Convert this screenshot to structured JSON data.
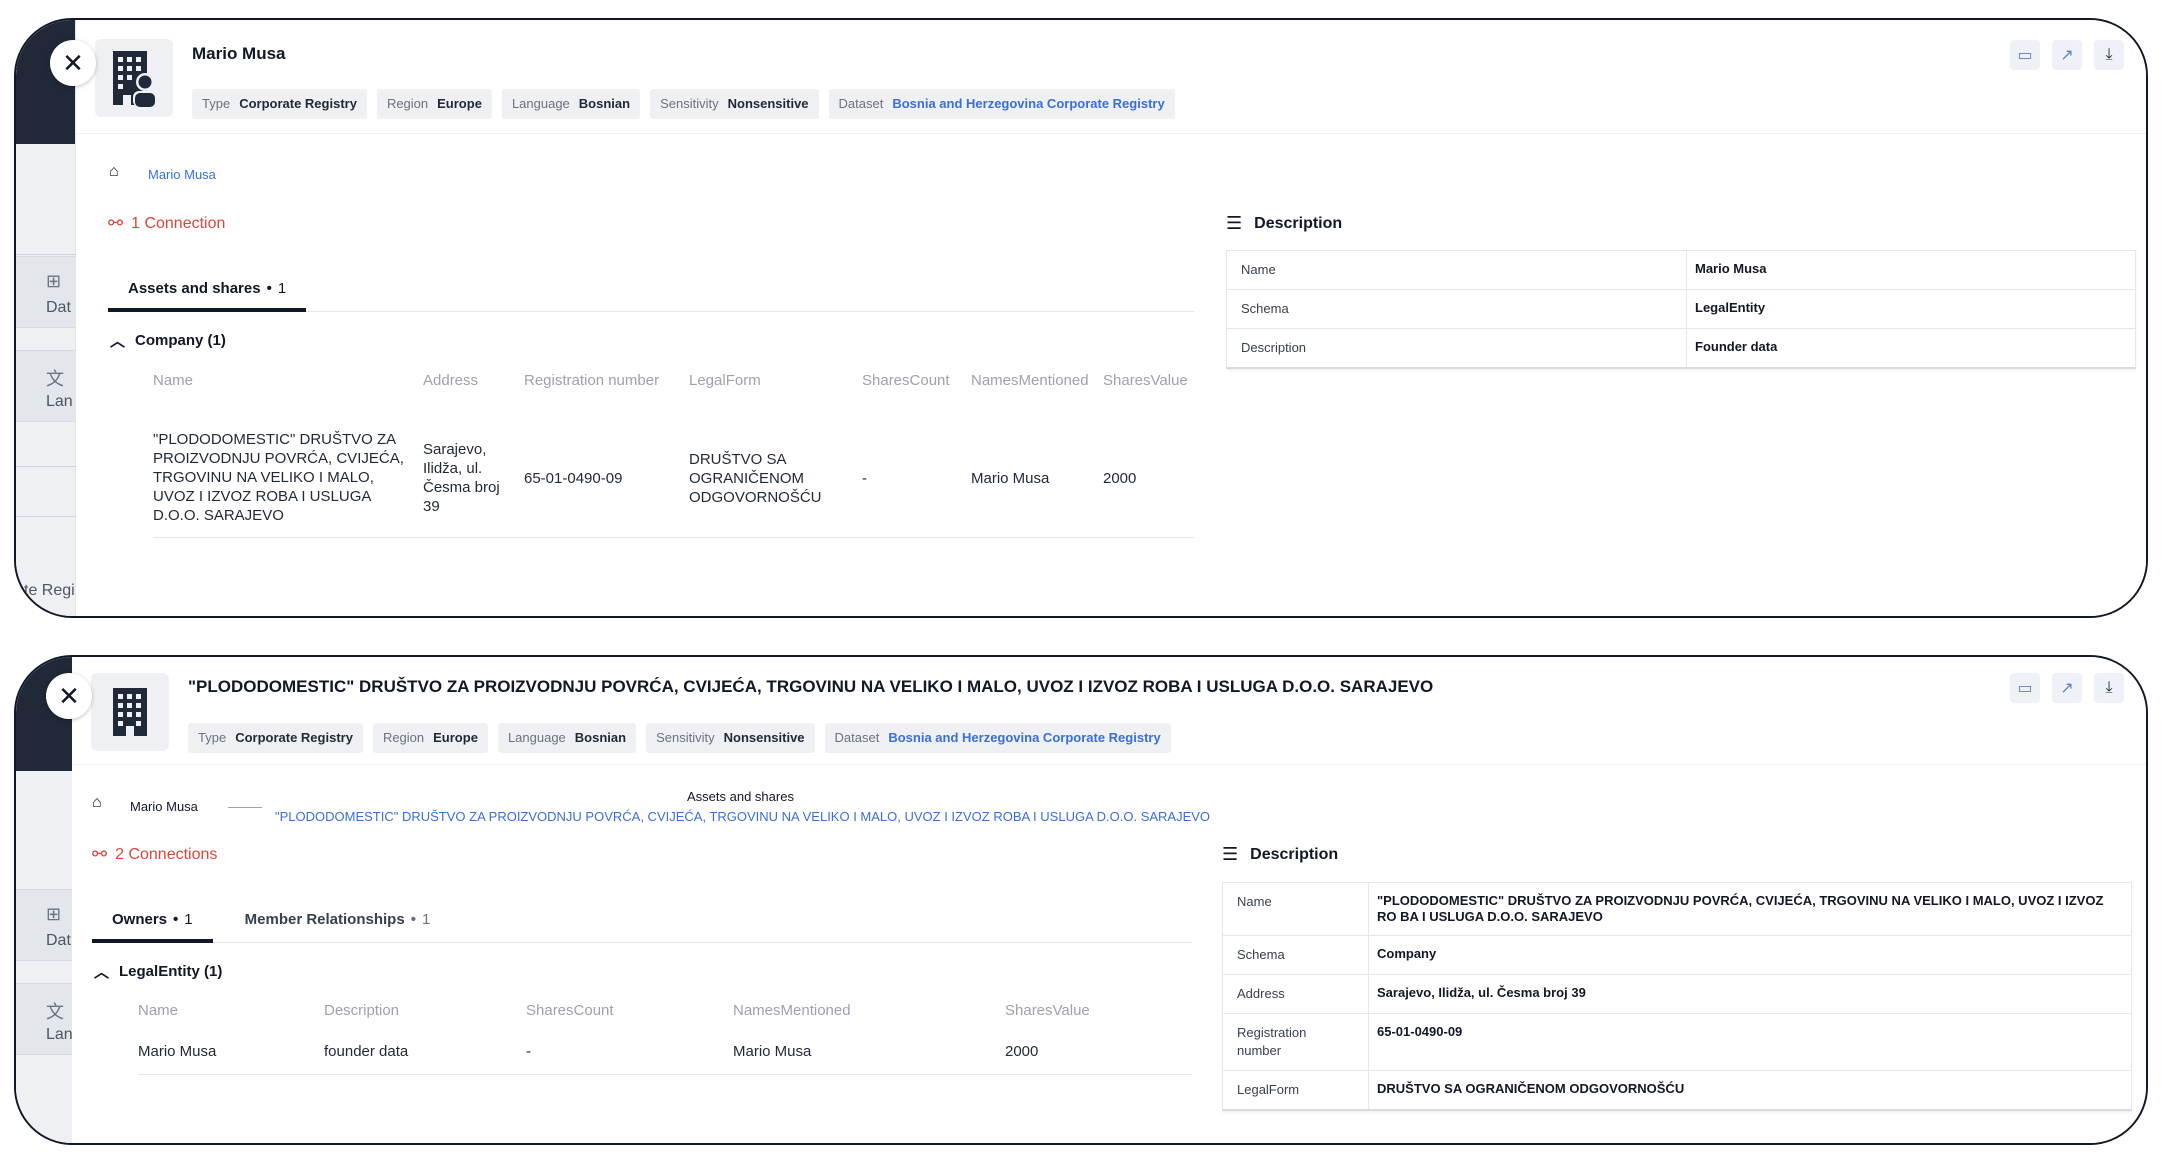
{
  "panel1": {
    "title": "Mario Musa",
    "bg": {
      "label_a": "Dat",
      "label_b": "Lan",
      "label_c": "te Regi"
    },
    "tags": [
      {
        "key": "Type",
        "value": "Corporate Registry"
      },
      {
        "key": "Region",
        "value": "Europe"
      },
      {
        "key": "Language",
        "value": "Bosnian"
      },
      {
        "key": "Sensitivity",
        "value": "Nonsensitive"
      },
      {
        "key": "Dataset",
        "value": "Bosnia and Herzegovina Corporate Registry"
      }
    ],
    "breadcrumb": {
      "current": "Mario Musa"
    },
    "connections": "1 Connection",
    "tab": {
      "label": "Assets and shares",
      "count": "1"
    },
    "group": "Company (1)",
    "table": {
      "headers": [
        "Name",
        "Address",
        "Registration number",
        "LegalForm",
        "SharesCount",
        "NamesMentioned",
        "SharesValue"
      ],
      "row": {
        "name": "\"PLODODOMESTIC\" DRUŠTVO ZA PROIZVODNJU POVRĆA, CVIJEĆA, TRGOVINU NA VELIKO I MALO, UVOZ I IZVOZ ROBA I USLUGA D.O.O. SARAJEVO",
        "address": "Sarajevo, Ilidža, ul. Česma broj 39",
        "registration": "65-01-0490-09",
        "legalform": "DRUŠTVO SA OGRANIČENOM ODGOVORNOŠĆU",
        "sharescount": "-",
        "names": "Mario Musa",
        "value": "2000"
      }
    },
    "description": {
      "title": "Description",
      "rows": [
        {
          "key": "Name",
          "value": "Mario Musa"
        },
        {
          "key": "Schema",
          "value": "LegalEntity"
        },
        {
          "key": "Description",
          "value": "Founder data"
        }
      ]
    }
  },
  "panel2": {
    "title": "\"PLODODOMESTIC\" DRUŠTVO ZA PROIZVODNJU POVRĆA, CVIJEĆA, TRGOVINU NA VELIKO I MALO, UVOZ I IZVOZ ROBA I USLUGA D.O.O. SARAJEVO",
    "bg": {
      "label_a": "Dat",
      "label_b": "Lan"
    },
    "tags": [
      {
        "key": "Type",
        "value": "Corporate Registry"
      },
      {
        "key": "Region",
        "value": "Europe"
      },
      {
        "key": "Language",
        "value": "Bosnian"
      },
      {
        "key": "Sensitivity",
        "value": "Nonsensitive"
      },
      {
        "key": "Dataset",
        "value": "Bosnia and Herzegovina Corporate Registry"
      }
    ],
    "breadcrumb": {
      "parent": "Mario Musa",
      "relation": "Assets and shares",
      "current": "\"PLODODOMESTIC\" DRUŠTVO ZA PROIZVODNJU POVRĆA, CVIJEĆA, TRGOVINU NA VELIKO I MALO, UVOZ I IZVOZ ROBA I USLUGA D.O.O. SARAJEVO"
    },
    "connections": "2 Connections",
    "tabs": [
      {
        "label": "Owners",
        "count": "1"
      },
      {
        "label": "Member Relationships",
        "count": "1"
      }
    ],
    "group": "LegalEntity (1)",
    "table": {
      "headers": [
        "Name",
        "Description",
        "SharesCount",
        "NamesMentioned",
        "SharesValue"
      ],
      "row": {
        "name": "Mario Musa",
        "description": "founder data",
        "sharescount": "-",
        "names": "Mario Musa",
        "value": "2000"
      }
    },
    "description": {
      "title": "Description",
      "rows": [
        {
          "key": "Name",
          "value": "\"PLODODOMESTIC\" DRUŠTVO ZA PROIZVODNJU POVRĆA, CVIJEĆA, TRGOVINU NA VELIKO I MALO, UVOZ I IZVOZ RO BA I USLUGA D.O.O. SARAJEVO"
        },
        {
          "key": "Schema",
          "value": "Company"
        },
        {
          "key": "Address",
          "value": "Sarajevo, Ilidža, ul. Česma broj 39"
        },
        {
          "key": "Registration number",
          "value": "65-01-0490-09"
        },
        {
          "key": "LegalForm",
          "value": "DRUŠTVO SA OGRANIČENOM ODGOVORNOŠĆU"
        }
      ]
    }
  }
}
